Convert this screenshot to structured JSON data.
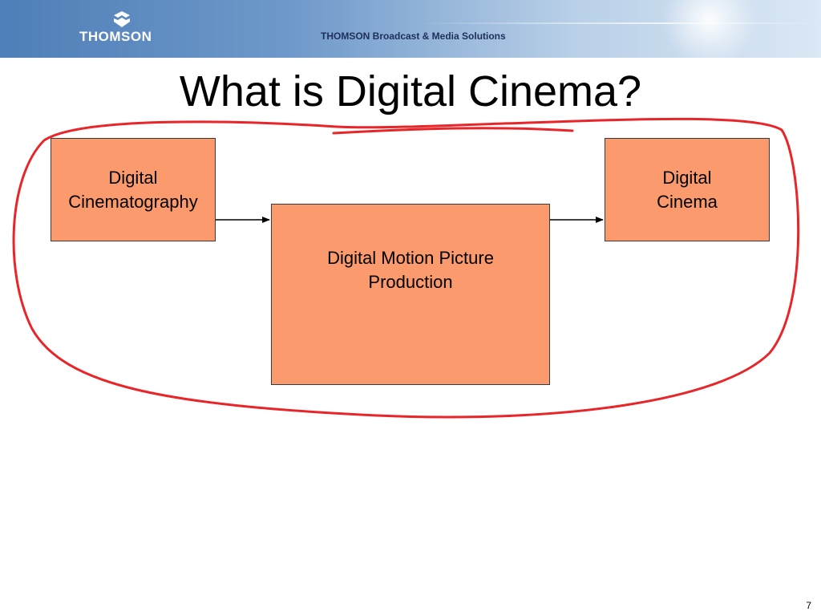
{
  "banner": {
    "logo_text": "THOMSON",
    "tagline": "THOMSON Broadcast & Media Solutions"
  },
  "slide": {
    "title": "What is Digital Cinema?",
    "page_number": "7"
  },
  "diagram": {
    "nodes": [
      {
        "id": "cinematography",
        "lines": [
          "Digital",
          "Cinematography"
        ]
      },
      {
        "id": "production",
        "lines": [
          "Digital Motion Picture",
          "Production"
        ]
      },
      {
        "id": "cinema",
        "lines": [
          "Digital",
          "Cinema"
        ]
      }
    ],
    "edges": [
      {
        "from": "cinematography",
        "to": "production"
      },
      {
        "from": "production",
        "to": "cinema"
      }
    ],
    "colors": {
      "box_fill": "#fb9a6c",
      "box_border": "#3a3a3a",
      "annotation": "#e8262a",
      "arrow": "#000000"
    }
  }
}
